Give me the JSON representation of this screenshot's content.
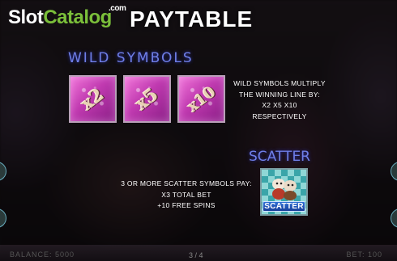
{
  "brand": {
    "slot": "Slot",
    "catalog": "Catalog",
    "com": ".com"
  },
  "header": {
    "title": "PAYTABLE"
  },
  "wild": {
    "title": "WILD  SYMBOLS",
    "tiles": [
      "x2",
      "x5",
      "x10"
    ],
    "desc_lines": [
      "WILD SYMBOLS MULTIPLY",
      "THE WINNING LINE BY:",
      "X2 X5 X10",
      "RESPECTIVELY"
    ]
  },
  "scatter": {
    "title": "SCATTER",
    "tile_label": "SCATTER",
    "desc_lines": [
      "3 OR MORE SCATTER  SYMBOLS PAY:",
      "X3 TOTAL BET",
      "+10 FREE SPINS"
    ]
  },
  "footer": {
    "balance_label": "BALANCE: 5000",
    "bet_label": "BET: 100",
    "page_indicator": "3 / 4"
  },
  "colors": {
    "accent_blue": "#6f7fe8",
    "wild_pink": "#c03ab0",
    "brand_green": "#7bbf3a"
  }
}
